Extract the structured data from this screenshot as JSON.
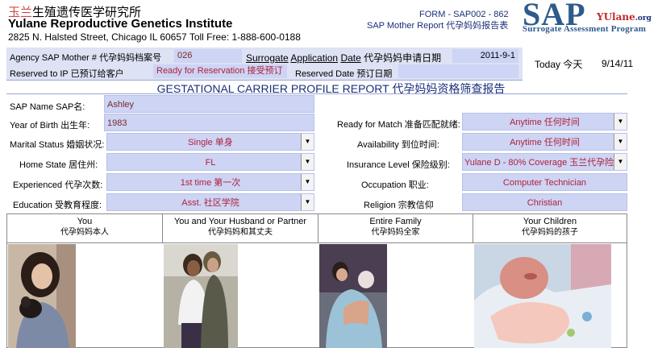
{
  "header": {
    "brand_cn_red": "玉兰",
    "brand_cn": "生殖遗传医学研究所",
    "institute": "Yulane Reproductive Genetics Institute",
    "address": "2825 N. Halsted Street, Chicago IL 60657  Toll Free: 1-888-600-0188",
    "form_id": "FORM - SAP002 - 862",
    "form_name": "SAP Mother Report 代孕妈妈报告表"
  },
  "logo": {
    "sap": "SAP",
    "yulane": "YUlane",
    "org": ".org",
    "program": "Surrogate Assessment Program"
  },
  "agency": {
    "agency_label": "Agency SAP Mother # 代孕妈妈档案号",
    "agency_value": "026",
    "surrogate": "Surrogate",
    "application": "Application",
    "date": "Date",
    "date_cn": "代孕妈妈申请日期",
    "app_date_value": "2011-9-1",
    "reserved_label": "Reserved to IP 已预订给客户",
    "ready_reservation": "Ready for Reservation 接受预订",
    "reserved_date_label": "Reserved Date 预订日期",
    "today_label": "Today 今天",
    "today_value": "9/14/11"
  },
  "title": "GESTATIONAL CARRIER PROFILE REPORT 代孕妈妈资格筛查报告",
  "profile": {
    "name_label": "SAP Name SAP名:",
    "name_value": "Ashley",
    "yob_label": "Year of Birth 出生年:",
    "yob_value": "1983",
    "marital_label": "Marital Status 婚姻状况:",
    "marital_value": "Single 单身",
    "home_label": "Home State 居住州:",
    "home_value": "FL",
    "exp_label": "Experienced 代孕次数:",
    "exp_value": "1st time  第一次",
    "edu_label": "Education 受教育程度:",
    "edu_value": "Asst. 社区学院",
    "ready_label": "Ready for Match 准备匹配就绪:",
    "ready_value": "Anytime 任何时间",
    "avail_label": "Availability 到位时间:",
    "avail_value": "Anytime 任何时间",
    "ins_label": "Insurance Level 保险级别:",
    "ins_value": "Yulane D - 80% Coverage 玉兰代孕险",
    "occ_label": "Occupation 职业:",
    "occ_value": "Computer Technician",
    "rel_label": "Religion 宗教信仰",
    "rel_value": "Christian"
  },
  "photos": [
    {
      "en": "You",
      "cn": "代孕妈妈本人"
    },
    {
      "en": "You and Your Husband or Partner",
      "cn": "代孕妈妈和其丈夫"
    },
    {
      "en": "Entire Family",
      "cn": "代孕妈妈全家"
    },
    {
      "en": "Your Children",
      "cn": "代孕妈妈的孩子"
    }
  ],
  "colors": {
    "accent_blue": "#1a2f7a",
    "field_bg": "#cdd4f4",
    "value_red": "#b0213b"
  }
}
